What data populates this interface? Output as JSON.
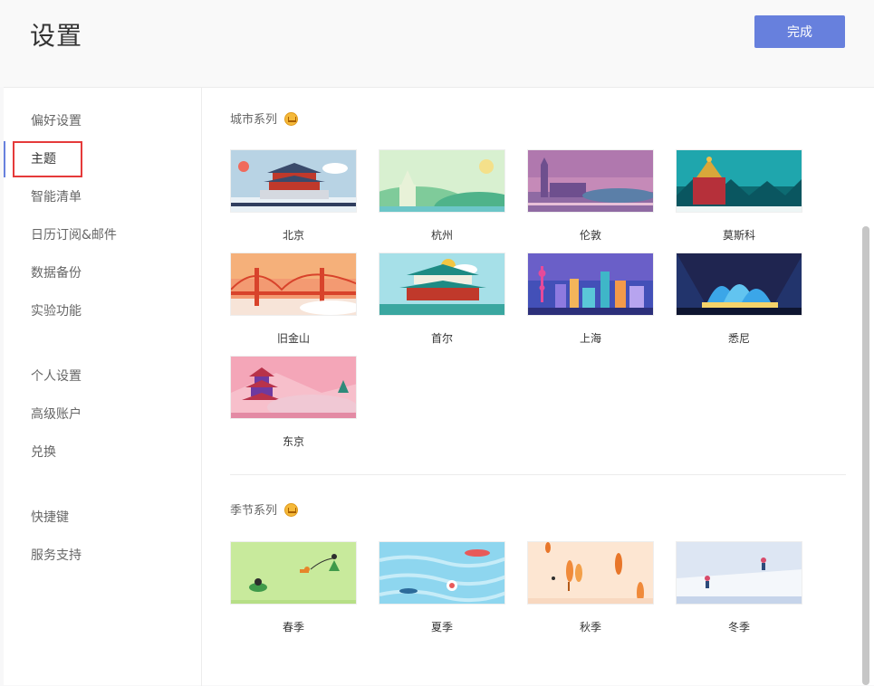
{
  "header": {
    "title": "设置",
    "done_label": "完成"
  },
  "sidebar": {
    "items": [
      {
        "label": "偏好设置"
      },
      {
        "label": "主题"
      },
      {
        "label": "智能清单"
      },
      {
        "label": "日历订阅&邮件"
      },
      {
        "label": "数据备份"
      },
      {
        "label": "实验功能"
      },
      {
        "label": "个人设置"
      },
      {
        "label": "高级账户"
      },
      {
        "label": "兑换"
      },
      {
        "label": "快捷键"
      },
      {
        "label": "服务支持"
      }
    ]
  },
  "city_section": {
    "title": "城市系列",
    "icon": "crown-icon",
    "themes": [
      {
        "label": "北京"
      },
      {
        "label": "杭州"
      },
      {
        "label": "伦敦"
      },
      {
        "label": "莫斯科"
      },
      {
        "label": "旧金山"
      },
      {
        "label": "首尔"
      },
      {
        "label": "上海"
      },
      {
        "label": "悉尼"
      },
      {
        "label": "东京"
      }
    ]
  },
  "season_section": {
    "title": "季节系列",
    "icon": "crown-icon",
    "themes": [
      {
        "label": "春季"
      },
      {
        "label": "夏季"
      },
      {
        "label": "秋季"
      },
      {
        "label": "冬季"
      }
    ]
  },
  "colors": {
    "accent": "#6780dd",
    "highlight": "#e53a3a"
  }
}
